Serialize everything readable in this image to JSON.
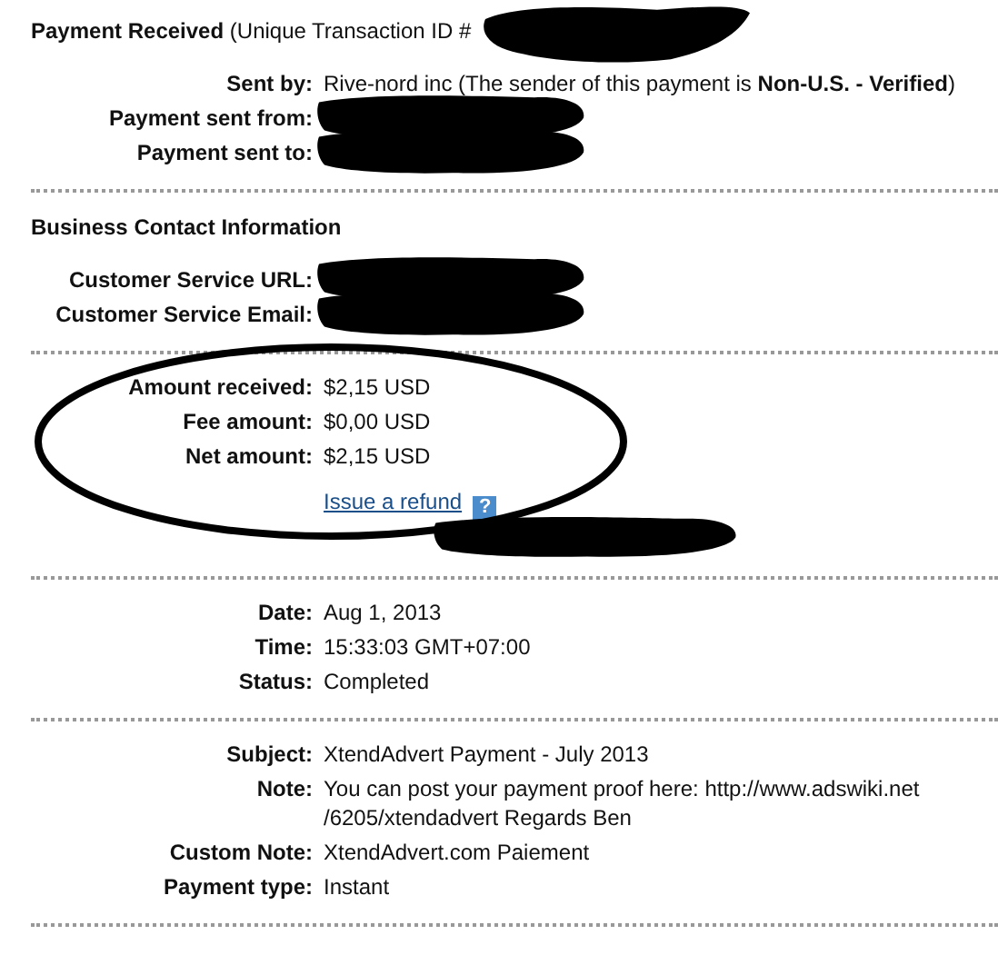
{
  "header": {
    "title": "Payment Received",
    "detail": "(Unique Transaction ID #",
    "redacted": true
  },
  "sections": [
    {
      "rows": [
        {
          "kind": "text",
          "label": "Sent by:",
          "value": "Rive-nord inc (The sender of this payment is **Non-U.S. - Verified**)"
        },
        {
          "kind": "redacted",
          "label": "Payment sent from:"
        },
        {
          "kind": "redacted",
          "label": "Payment sent to:"
        }
      ]
    },
    {
      "heading": "Business Contact Information",
      "rows": [
        {
          "kind": "redacted",
          "label": "Customer Service URL:"
        },
        {
          "kind": "redacted",
          "label": "Customer Service Email:"
        }
      ]
    },
    {
      "circled": true,
      "rows": [
        {
          "kind": "text",
          "label": "Amount received:",
          "value": "$2,15 USD"
        },
        {
          "kind": "text",
          "label": "Fee amount:",
          "value": "$0,00 USD"
        },
        {
          "kind": "text",
          "label": "Net amount:",
          "value": "$2,15 USD"
        },
        {
          "kind": "link",
          "value": "Issue a refund",
          "help": "?"
        },
        {
          "kind": "redacted"
        }
      ]
    },
    {
      "rows": [
        {
          "kind": "text",
          "label": "Date:",
          "value": "Aug 1, 2013"
        },
        {
          "kind": "text",
          "label": "Time:",
          "value": "15:33:03 GMT+07:00"
        },
        {
          "kind": "text",
          "label": "Status:",
          "value": "Completed"
        }
      ]
    },
    {
      "rows": [
        {
          "kind": "text",
          "label": "Subject:",
          "value": "XtendAdvert Payment - July 2013"
        },
        {
          "kind": "text",
          "label": "Note:",
          "value": "You can post your payment proof here: http://www.adswiki.net /6205/xtendadvert Regards Ben"
        },
        {
          "kind": "text",
          "label": "Custom Note:",
          "value": "XtendAdvert.com Paiement"
        },
        {
          "kind": "text",
          "label": "Payment type:",
          "value": "Instant"
        }
      ]
    }
  ]
}
